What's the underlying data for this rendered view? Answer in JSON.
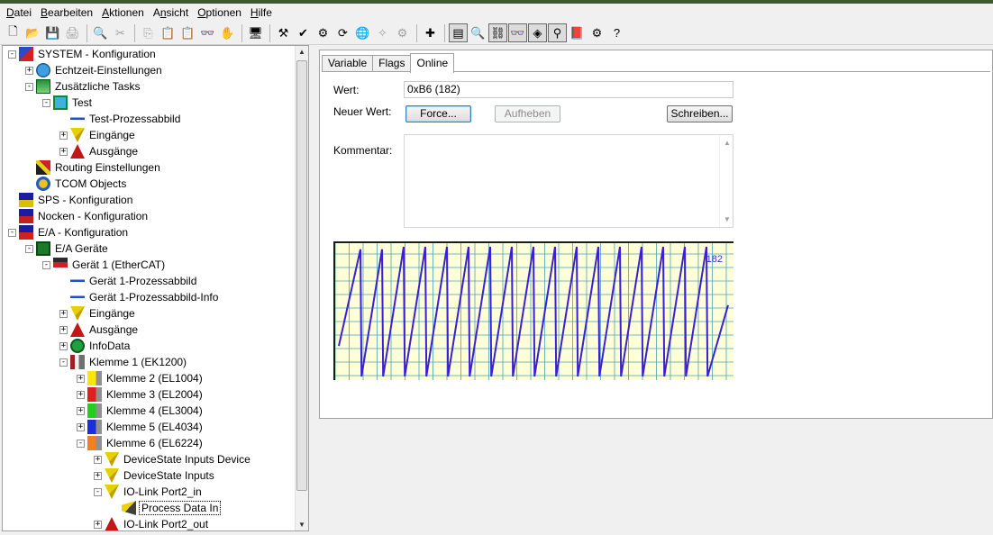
{
  "menu": [
    {
      "label": "Datei",
      "accel": "D",
      "rest": "atei"
    },
    {
      "label": "Bearbeiten",
      "accel": "B",
      "rest": "earbeiten"
    },
    {
      "label": "Aktionen",
      "accel": "A",
      "rest": "ktionen"
    },
    {
      "label": "Ansicht",
      "accel": "n",
      "pre": "A",
      "rest": "sicht"
    },
    {
      "label": "Optionen",
      "accel": "O",
      "rest": "ptionen"
    },
    {
      "label": "Hilfe",
      "accel": "H",
      "rest": "ilfe"
    }
  ],
  "toolbar": {
    "icons": [
      "new-icon",
      "open-icon",
      "save-icon",
      "print-icon",
      "print-preview-icon",
      "cut-icon",
      "copy-icon",
      "paste-icon",
      "paste-special-icon",
      "find-icon",
      "hand-icon",
      "monitor-icon",
      "build-icon",
      "check-icon",
      "activate-icon",
      "restart-icon",
      "globe-icon",
      "wand-icon",
      "gear-icon",
      "add-icon",
      "list-view-icon",
      "zoom-icon",
      "link-icon",
      "glasses-icon",
      "online-icon",
      "mapping-icon",
      "book-icon",
      "settings-icon",
      "help-icon"
    ]
  },
  "tree": {
    "items": [
      {
        "label": "SYSTEM - Konfiguration",
        "depth": 0,
        "exp": "-",
        "icon": "system"
      },
      {
        "label": "Echtzeit-Einstellungen",
        "depth": 1,
        "exp": "+",
        "icon": "globe"
      },
      {
        "label": "Zusätzliche Tasks",
        "depth": 1,
        "exp": "-",
        "icon": "tasks"
      },
      {
        "label": "Test",
        "depth": 2,
        "exp": "-",
        "icon": "task"
      },
      {
        "label": "Test-Prozessabbild",
        "depth": 3,
        "exp": "",
        "icon": "image"
      },
      {
        "label": "Eingänge",
        "depth": 3,
        "exp": "+",
        "icon": "inputs"
      },
      {
        "label": "Ausgänge",
        "depth": 3,
        "exp": "+",
        "icon": "outputs"
      },
      {
        "label": "Routing Einstellungen",
        "depth": 1,
        "exp": "",
        "icon": "routing"
      },
      {
        "label": "TCOM Objects",
        "depth": 1,
        "exp": "",
        "icon": "tcom"
      },
      {
        "label": "SPS - Konfiguration",
        "depth": 0,
        "exp": "",
        "icon": "plc"
      },
      {
        "label": "Nocken - Konfiguration",
        "depth": 0,
        "exp": "",
        "icon": "cam"
      },
      {
        "label": "E/A - Konfiguration",
        "depth": 0,
        "exp": "-",
        "icon": "io"
      },
      {
        "label": "E/A Geräte",
        "depth": 1,
        "exp": "-",
        "icon": "devices"
      },
      {
        "label": "Gerät 1 (EtherCAT)",
        "depth": 2,
        "exp": "-",
        "icon": "ethercat"
      },
      {
        "label": "Gerät 1-Prozessabbild",
        "depth": 3,
        "exp": "",
        "icon": "image"
      },
      {
        "label": "Gerät 1-Prozessabbild-Info",
        "depth": 3,
        "exp": "",
        "icon": "image"
      },
      {
        "label": "Eingänge",
        "depth": 3,
        "exp": "+",
        "icon": "inputs"
      },
      {
        "label": "Ausgänge",
        "depth": 3,
        "exp": "+",
        "icon": "outputs"
      },
      {
        "label": "InfoData",
        "depth": 3,
        "exp": "+",
        "icon": "infodata"
      },
      {
        "label": "Klemme 1 (EK1200)",
        "depth": 3,
        "exp": "-",
        "icon": "coupler"
      },
      {
        "label": "Klemme 2 (EL1004)",
        "depth": 4,
        "exp": "+",
        "icon": "term-yellow"
      },
      {
        "label": "Klemme 3 (EL2004)",
        "depth": 4,
        "exp": "+",
        "icon": "term-red"
      },
      {
        "label": "Klemme 4 (EL3004)",
        "depth": 4,
        "exp": "+",
        "icon": "term-green"
      },
      {
        "label": "Klemme 5 (EL4034)",
        "depth": 4,
        "exp": "+",
        "icon": "term-blue"
      },
      {
        "label": "Klemme 6 (EL6224)",
        "depth": 4,
        "exp": "-",
        "icon": "term-orange"
      },
      {
        "label": "DeviceState Inputs Device",
        "depth": 5,
        "exp": "+",
        "icon": "inputs"
      },
      {
        "label": "DeviceState Inputs",
        "depth": 5,
        "exp": "+",
        "icon": "inputs"
      },
      {
        "label": "IO-Link Port2_in",
        "depth": 5,
        "exp": "-",
        "icon": "inputs"
      },
      {
        "label": "Process Data In",
        "depth": 6,
        "exp": "",
        "icon": "var-in",
        "selected": true
      },
      {
        "label": "IO-Link Port2_out",
        "depth": 5,
        "exp": "+",
        "icon": "outputs"
      }
    ]
  },
  "tabs": [
    {
      "label": "Variable",
      "active": false
    },
    {
      "label": "Flags",
      "active": false
    },
    {
      "label": "Online",
      "active": true
    }
  ],
  "online": {
    "value_label": "Wert:",
    "value": "0xB6 (182)",
    "new_value_label": "Neuer Wert:",
    "force_label": "Force...",
    "release_label": "Aufheben",
    "write_label": "Schreiben...",
    "comment_label": "Kommentar:",
    "comment_value": ""
  },
  "chart_data": {
    "type": "line",
    "title": "",
    "xlabel": "",
    "ylabel": "",
    "annotation": "182",
    "series": [
      {
        "color": "#3a1fd6",
        "x": [
          0,
          1,
          1.05,
          2,
          2.05,
          3,
          3.05,
          4,
          4.05,
          5,
          5.05,
          6,
          6.05,
          7,
          7.05,
          8,
          8.05,
          9,
          9.05,
          10,
          10.05,
          11,
          11.05,
          12,
          12.05,
          13,
          13.05,
          14,
          14.05,
          15,
          15.05,
          16,
          16.05,
          17,
          17.05,
          18
        ],
        "y": [
          60,
          250,
          0,
          250,
          0,
          255,
          0,
          255,
          0,
          255,
          0,
          255,
          0,
          255,
          0,
          255,
          0,
          255,
          0,
          255,
          0,
          255,
          0,
          255,
          0,
          255,
          0,
          255,
          0,
          255,
          0,
          255,
          0,
          255,
          0,
          140
        ]
      }
    ],
    "ylim": [
      0,
      255
    ],
    "grid": true,
    "background": "#ffffd8",
    "grid_color": "#4aa3b8"
  }
}
